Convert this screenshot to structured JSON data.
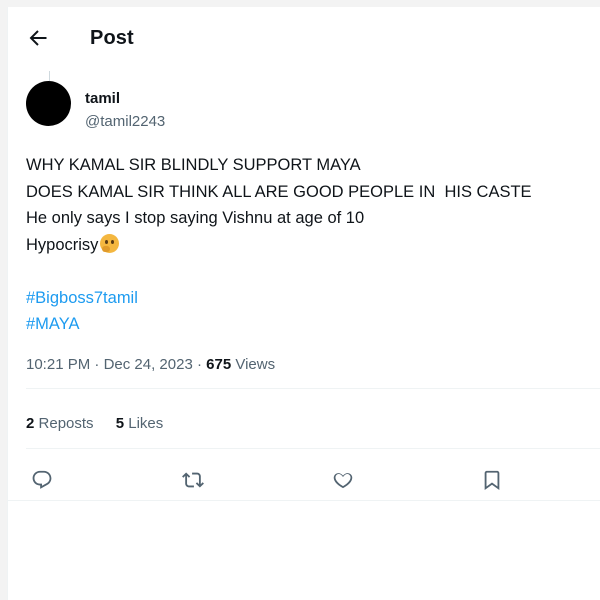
{
  "header": {
    "back_icon": "arrow-left-icon",
    "title": "Post"
  },
  "author": {
    "display_name": "tamil",
    "handle": "@tamil2243"
  },
  "tweet": {
    "lines": [
      "WHY KAMAL SIR BLINDLY SUPPORT MAYA",
      "DOES KAMAL SIR THINK ALL ARE GOOD PEOPLE IN  HIS CASTE",
      "He only says I stop saying Vishnu at age of 10",
      "Hypocrisy"
    ],
    "emoji": "thinking-face-emoji",
    "hashtags": [
      "#Bigboss7tamil",
      "#MAYA"
    ]
  },
  "meta": {
    "time": "10:21 PM",
    "separator": "·",
    "date": "Dec 24, 2023",
    "views_count": "675",
    "views_label": "Views"
  },
  "stats": {
    "reposts_count": "2",
    "reposts_label": "Reposts",
    "likes_count": "5",
    "likes_label": "Likes"
  },
  "actions": {
    "reply_icon": "reply-icon",
    "repost_icon": "repost-icon",
    "like_icon": "heart-icon",
    "bookmark_icon": "bookmark-icon"
  },
  "colors": {
    "link": "#1d9bf0",
    "secondary_text": "#536471",
    "primary_text": "#0f1419"
  }
}
